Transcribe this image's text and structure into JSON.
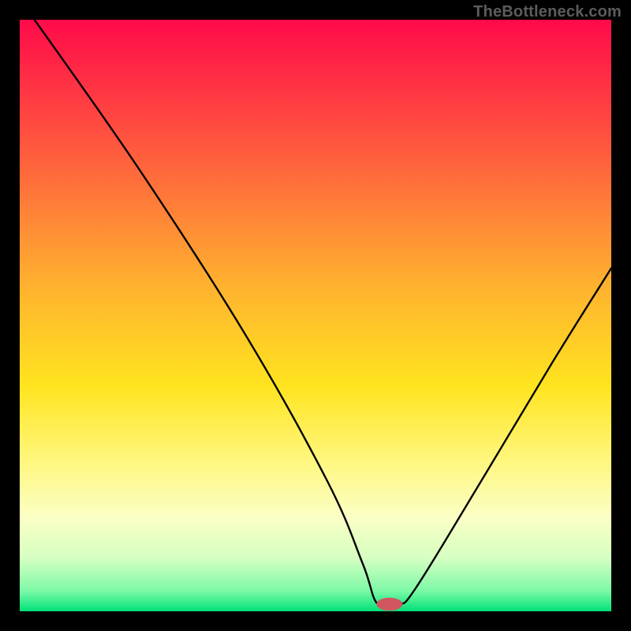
{
  "watermark": "TheBottleneck.com",
  "chart_data": {
    "type": "line",
    "title": "",
    "xlabel": "",
    "ylabel": "",
    "xlim": [
      0,
      100
    ],
    "ylim": [
      0,
      100
    ],
    "gradient_stops": [
      {
        "offset": 0,
        "color": "#ff0a4a"
      },
      {
        "offset": 0.22,
        "color": "#ff5a3e"
      },
      {
        "offset": 0.45,
        "color": "#ffb22f"
      },
      {
        "offset": 0.62,
        "color": "#ffe41f"
      },
      {
        "offset": 0.74,
        "color": "#fff67a"
      },
      {
        "offset": 0.84,
        "color": "#fbffc4"
      },
      {
        "offset": 0.91,
        "color": "#d6ffc2"
      },
      {
        "offset": 0.965,
        "color": "#7df9a7"
      },
      {
        "offset": 1.0,
        "color": "#00e27a"
      }
    ],
    "series": [
      {
        "name": "bottleneck-curve",
        "color": "#000000",
        "stroke_width": 2.4,
        "points": [
          {
            "x": 2.5,
            "y": 100
          },
          {
            "x": 20,
            "y": 75
          },
          {
            "x": 38,
            "y": 47
          },
          {
            "x": 52,
            "y": 22
          },
          {
            "x": 58,
            "y": 8
          },
          {
            "x": 60.5,
            "y": 1.2
          },
          {
            "x": 64,
            "y": 1.2
          },
          {
            "x": 67,
            "y": 4
          },
          {
            "x": 78,
            "y": 22
          },
          {
            "x": 90,
            "y": 42
          },
          {
            "x": 100,
            "y": 58
          }
        ]
      }
    ],
    "marker": {
      "name": "target-marker",
      "x": 62.5,
      "y": 1.2,
      "rx": 2.2,
      "ry": 1.1,
      "color": "#d1575f"
    }
  }
}
